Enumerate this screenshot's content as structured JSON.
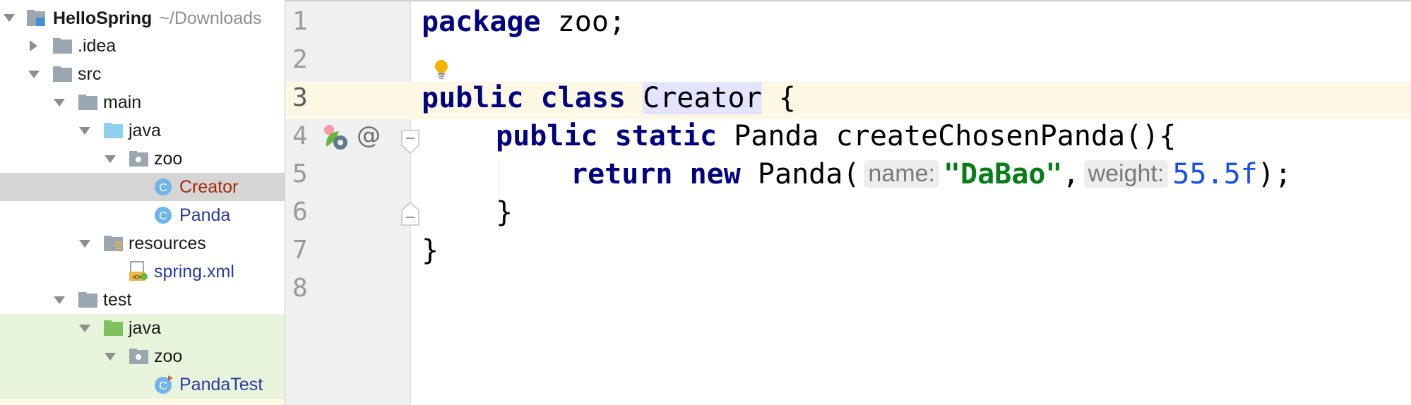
{
  "project_tree": {
    "root": {
      "label": "HelloSpring",
      "path": "~/Downloads"
    },
    "items": [
      {
        "label": ".idea"
      },
      {
        "label": "src"
      },
      {
        "label": "main"
      },
      {
        "label": "java"
      },
      {
        "label": "zoo"
      },
      {
        "label": "Creator"
      },
      {
        "label": "Panda"
      },
      {
        "label": "resources"
      },
      {
        "label": "spring.xml"
      },
      {
        "label": "test"
      },
      {
        "label": "java"
      },
      {
        "label": "zoo"
      },
      {
        "label": "PandaTest"
      }
    ]
  },
  "editor": {
    "line_numbers": [
      "1",
      "2",
      "3",
      "4",
      "5",
      "6",
      "7",
      "8"
    ],
    "line1": {
      "kw": "package",
      "rest": " zoo;"
    },
    "line3": {
      "kw1": "public",
      "kw2": "class",
      "name": "Creator",
      "rest": " {"
    },
    "line4": {
      "kw1": "public",
      "kw2": "static",
      "rest": " Panda createChosenPanda(){"
    },
    "line5": {
      "kw1": "return",
      "kw2": "new",
      "call": " Panda(",
      "hint1": "name:",
      "str": "\"DaBao\"",
      "comma": ",",
      "hint2": "weight:",
      "num": "55.5f",
      "end": ");"
    },
    "line6": "}",
    "line7": "}"
  },
  "colors": {
    "keyword": "#000080",
    "string": "#067d17",
    "number": "#1750eb",
    "selected_row": "#d5d5d5",
    "test_row": "#e8f5dc",
    "current_line": "#fdf8e4"
  }
}
